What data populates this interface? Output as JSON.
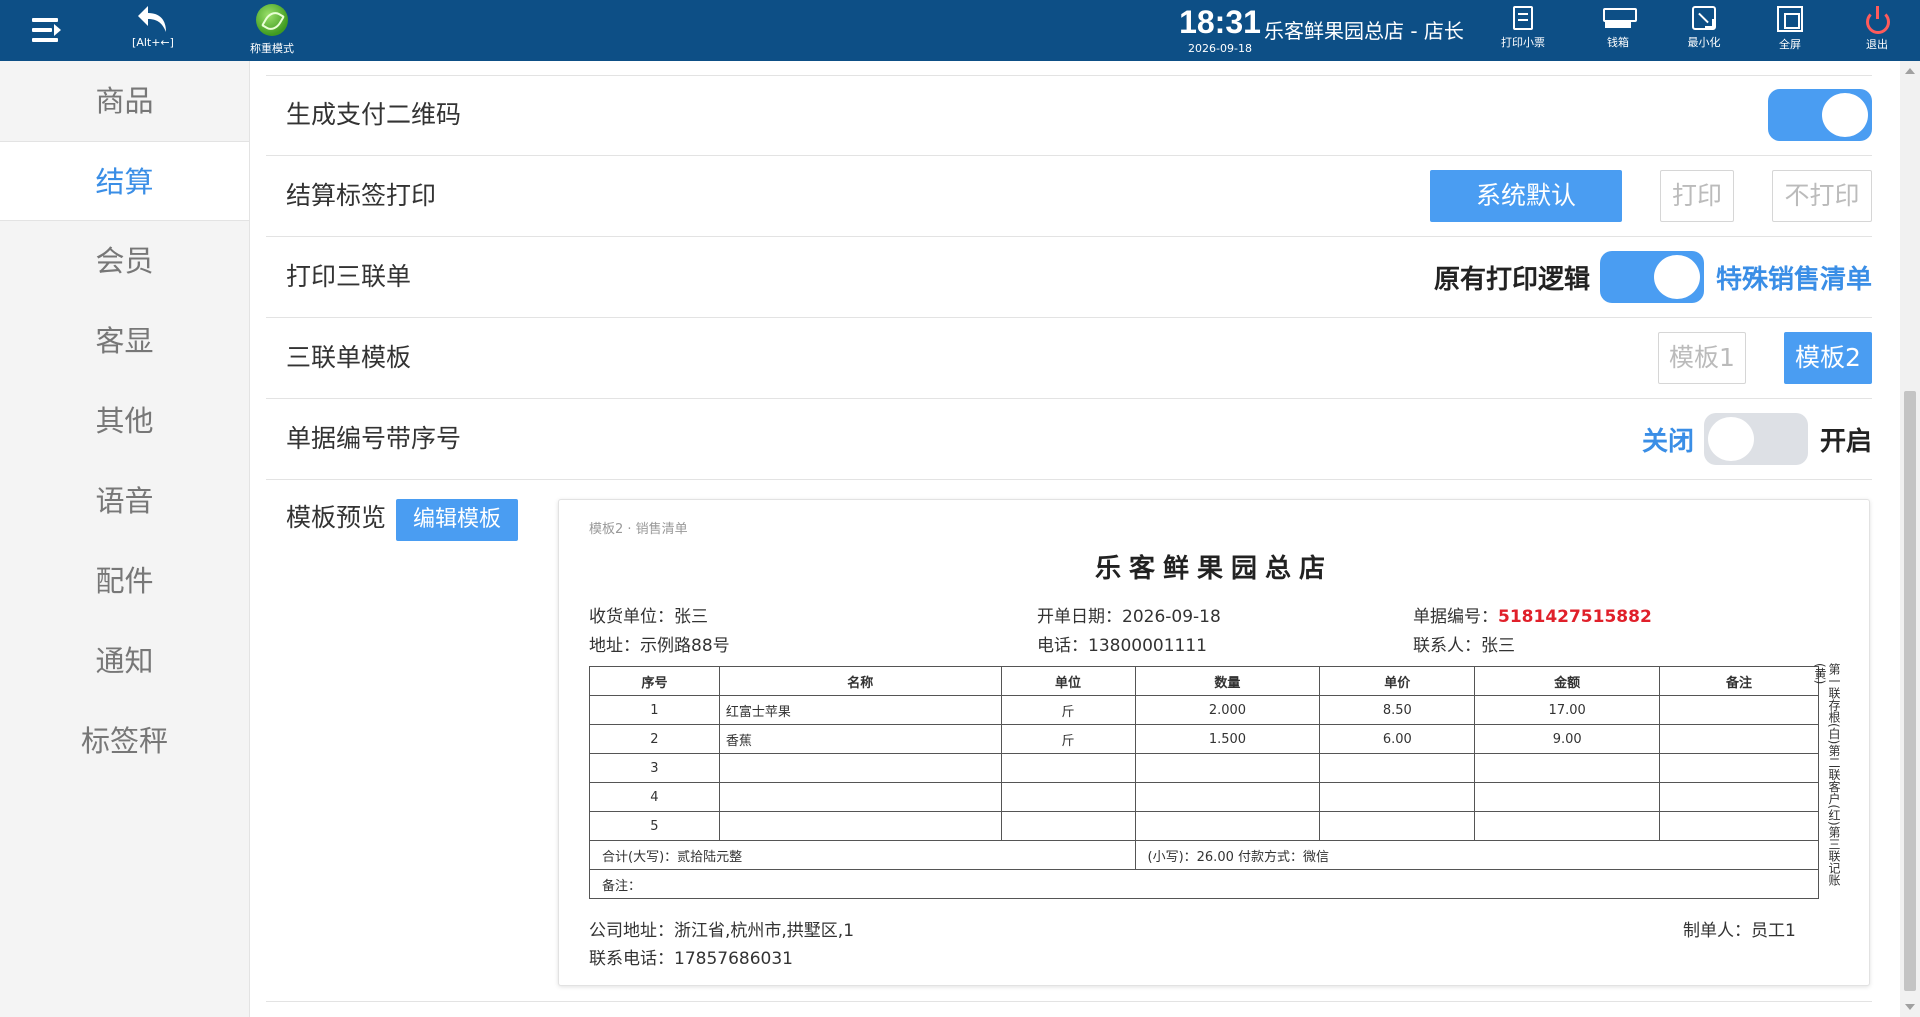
{
  "topbar": {
    "back_label": "[Alt+←]",
    "scale_mode_label": "称重模式",
    "time": "18:31",
    "date": "2026-09-18",
    "store_user": "乐客鲜果园总店 - 店长",
    "actions": [
      {
        "label": "打印小票",
        "icon": "receipt-icon"
      },
      {
        "label": "钱箱",
        "icon": "cash-drawer-icon"
      },
      {
        "label": "最小化",
        "icon": "minimize-icon"
      },
      {
        "label": "全屏",
        "icon": "fullscreen-icon"
      },
      {
        "label": "退出",
        "icon": "power-icon"
      }
    ],
    "colors": {
      "bar": "#0d4f86",
      "exit": "#ff5b5b"
    }
  },
  "sidebar": {
    "items": [
      {
        "label": "商品"
      },
      {
        "label": "结算",
        "active": true
      },
      {
        "label": "会员"
      },
      {
        "label": "客显"
      },
      {
        "label": "其他"
      },
      {
        "label": "语音"
      },
      {
        "label": "配件"
      },
      {
        "label": "通知"
      },
      {
        "label": "标签秤"
      }
    ]
  },
  "settings": {
    "qr": {
      "label": "生成支付二维码",
      "enabled": true
    },
    "label_print": {
      "label": "结算标签打印",
      "options": [
        "系统默认",
        "打印",
        "不打印"
      ],
      "selected": "系统默认"
    },
    "triplicate": {
      "label": "打印三联单",
      "left": "原有打印逻辑",
      "right": "特殊销售清单",
      "enabled": true
    },
    "template": {
      "label": "三联单模板",
      "options": [
        "模板1",
        "模板2"
      ],
      "selected": "模板2"
    },
    "serial": {
      "label": "单据编号带序号",
      "off": "关闭",
      "on": "开启",
      "enabled": false
    },
    "preview": {
      "label": "模板预览",
      "edit_button": "编辑模板"
    }
  },
  "receipt": {
    "tag": "模板2 · 销售清单",
    "title": "乐客鲜果园总店",
    "customer": "收货单位：张三",
    "open_date": "开单日期：2026-09-18",
    "doc_no_label": "单据编号：",
    "doc_no": "5181427515882",
    "address": "地址：示例路88号",
    "phone": "电话：13800001111",
    "contact": "联系人：张三",
    "columns": [
      "序号",
      "名称",
      "单位",
      "数量",
      "单价",
      "金额",
      "备注"
    ],
    "rows": [
      {
        "no": "1",
        "name": "红富士苹果",
        "unit": "斤",
        "qty": "2.000",
        "price": "8.50",
        "amount": "17.00",
        "note": ""
      },
      {
        "no": "2",
        "name": "香蕉",
        "unit": "斤",
        "qty": "1.500",
        "price": "6.00",
        "amount": "9.00",
        "note": ""
      },
      {
        "no": "3",
        "name": "",
        "unit": "",
        "qty": "",
        "price": "",
        "amount": "",
        "note": ""
      },
      {
        "no": "4",
        "name": "",
        "unit": "",
        "qty": "",
        "price": "",
        "amount": "",
        "note": ""
      },
      {
        "no": "5",
        "name": "",
        "unit": "",
        "qty": "",
        "price": "",
        "amount": "",
        "note": ""
      }
    ],
    "total_upper": "合计(大写)：贰拾陆元整",
    "total_lower": "(小写)：26.00 付款方式：微信",
    "remark": "备注：",
    "side_note": "第一联存根(白)第二联客户(红)第三联记账(黄)",
    "company_address": "公司地址：浙江省,杭州市,拱墅区,1",
    "company_phone": "联系电话：17857686031",
    "maker": "制单人：员工1"
  },
  "accent_color": "#4a9df2",
  "active_color": "#3a8ee6",
  "doc_no_color": "#e0202a"
}
